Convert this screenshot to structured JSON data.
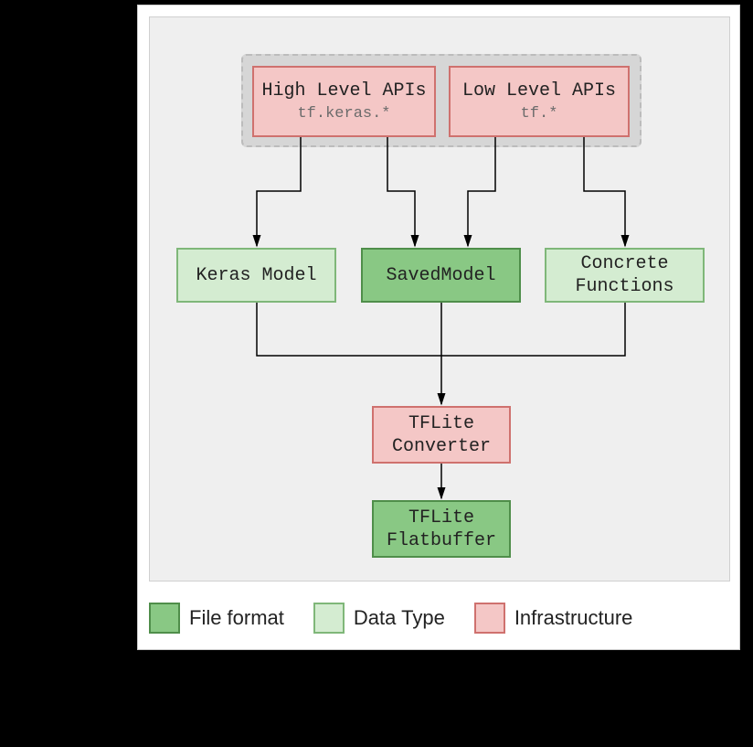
{
  "nodes": {
    "high_level": {
      "title": "High Level APIs",
      "sub": "tf.keras.*"
    },
    "low_level": {
      "title": "Low Level APIs",
      "sub": "tf.*"
    },
    "keras_model": {
      "title": "Keras Model"
    },
    "saved_model": {
      "title": "SavedModel"
    },
    "concrete_functions": {
      "title": "Concrete\nFunctions"
    },
    "tflite_converter": {
      "title": "TFLite\nConverter"
    },
    "tflite_flatbuffer": {
      "title": "TFLite\nFlatbuffer"
    }
  },
  "legend": {
    "file_format": "File format",
    "data_type": "Data Type",
    "infrastructure": "Infrastructure"
  },
  "colors": {
    "infrastructure_fill": "#f4c7c6",
    "infrastructure_border": "#cf716e",
    "datatype_fill": "#d4ecd1",
    "datatype_border": "#7fb779",
    "fileformat_fill": "#89c884",
    "fileformat_border": "#4f8e4a"
  },
  "edges": [
    {
      "from": "high_level",
      "to": "keras_model"
    },
    {
      "from": "high_level",
      "to": "saved_model"
    },
    {
      "from": "low_level",
      "to": "saved_model"
    },
    {
      "from": "low_level",
      "to": "concrete_functions"
    },
    {
      "from": "keras_model",
      "to": "tflite_converter"
    },
    {
      "from": "saved_model",
      "to": "tflite_converter"
    },
    {
      "from": "concrete_functions",
      "to": "tflite_converter"
    },
    {
      "from": "tflite_converter",
      "to": "tflite_flatbuffer"
    }
  ]
}
